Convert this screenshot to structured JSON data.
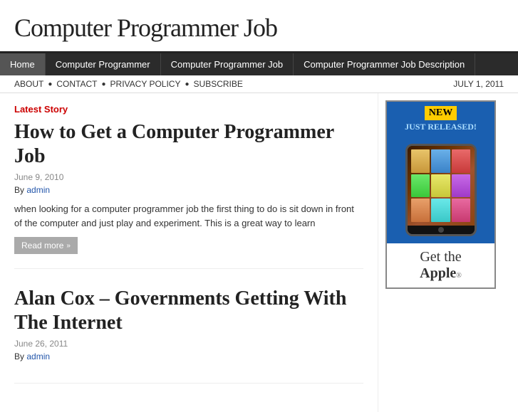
{
  "site": {
    "title": "Computer Programmer Job"
  },
  "nav": {
    "items": [
      {
        "label": "Home",
        "class": "first"
      },
      {
        "label": "Computer Programmer"
      },
      {
        "label": "Computer Programmer Job"
      },
      {
        "label": "Computer Programmer Job Description"
      }
    ]
  },
  "subnav": {
    "links": [
      "ABOUT",
      "CONTACT",
      "PRIVACY POLICY",
      "SUBSCRIBE"
    ],
    "date": "JULY 1, 2011"
  },
  "latest_story_label": "Latest Story",
  "articles": [
    {
      "title": "How to Get a Computer Programmer Job",
      "date": "June 9, 2010",
      "author": "admin",
      "excerpt": "when looking for a computer programmer job the first thing to do is sit down in front of the computer and just play and experiment. This is a great way to learn",
      "read_more": "Read more"
    },
    {
      "title": "Alan Cox – Governments Getting With The Internet",
      "date": "June 26, 2011",
      "author": "admin",
      "excerpt": "",
      "read_more": ""
    }
  ],
  "sidebar": {
    "ad": {
      "new_label": "NEW",
      "just_released": "JUST RELEASED!",
      "get_the": "Get the",
      "apple_label": "Apple",
      "trademark": "®"
    }
  }
}
